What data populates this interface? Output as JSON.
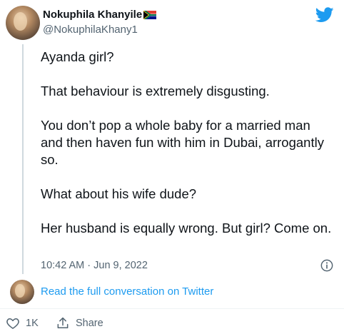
{
  "user": {
    "name": "Nokuphila Khanyile",
    "handle": "@NokuphilaKhany1",
    "flag_icon": "south-africa-flag-icon"
  },
  "brand": {
    "icon": "twitter-bird-icon",
    "color": "#1d9bf0"
  },
  "tweet": {
    "paragraphs": [
      "Ayanda girl?",
      "That behaviour is extremely disgusting.",
      "You don’t pop a whole baby for a married man and then haven fun with him in Dubai, arrogantly so.",
      "What about his wife dude?",
      "Her husband is equally wrong. But girl? Come on."
    ],
    "timestamp": "10:42 AM · Jun 9, 2022",
    "info_icon": "info-icon"
  },
  "conversation_link": "Read the full conversation on Twitter",
  "actions": {
    "like_icon": "heart-icon",
    "like_count": "1K",
    "share_icon": "share-icon",
    "share_label": "Share"
  }
}
